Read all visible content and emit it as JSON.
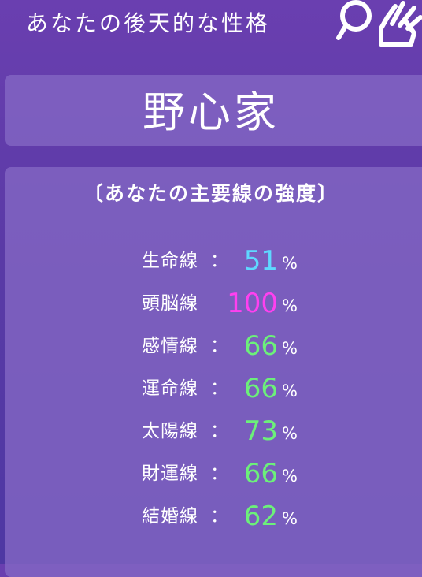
{
  "header": {
    "title": "あなたの後天的な性格",
    "icon": "magnifier-hand-icon"
  },
  "result": {
    "personality": "野心家"
  },
  "lines_section": {
    "heading": "〔あなたの主要線の強度〕",
    "percent_symbol": "%",
    "colon": "：",
    "items": [
      {
        "label": "生命線",
        "value": "51",
        "color": "#5fd8ff"
      },
      {
        "label": "頭脳線",
        "value": "100",
        "color": "#ff40f0"
      },
      {
        "label": "感情線",
        "value": "66",
        "color": "#6cf07a"
      },
      {
        "label": "運命線",
        "value": "66",
        "color": "#6cf07a"
      },
      {
        "label": "太陽線",
        "value": "73",
        "color": "#6cf07a"
      },
      {
        "label": "財運線",
        "value": "66",
        "color": "#6cf07a"
      },
      {
        "label": "結婚線",
        "value": "62",
        "color": "#6cf07a"
      }
    ]
  }
}
